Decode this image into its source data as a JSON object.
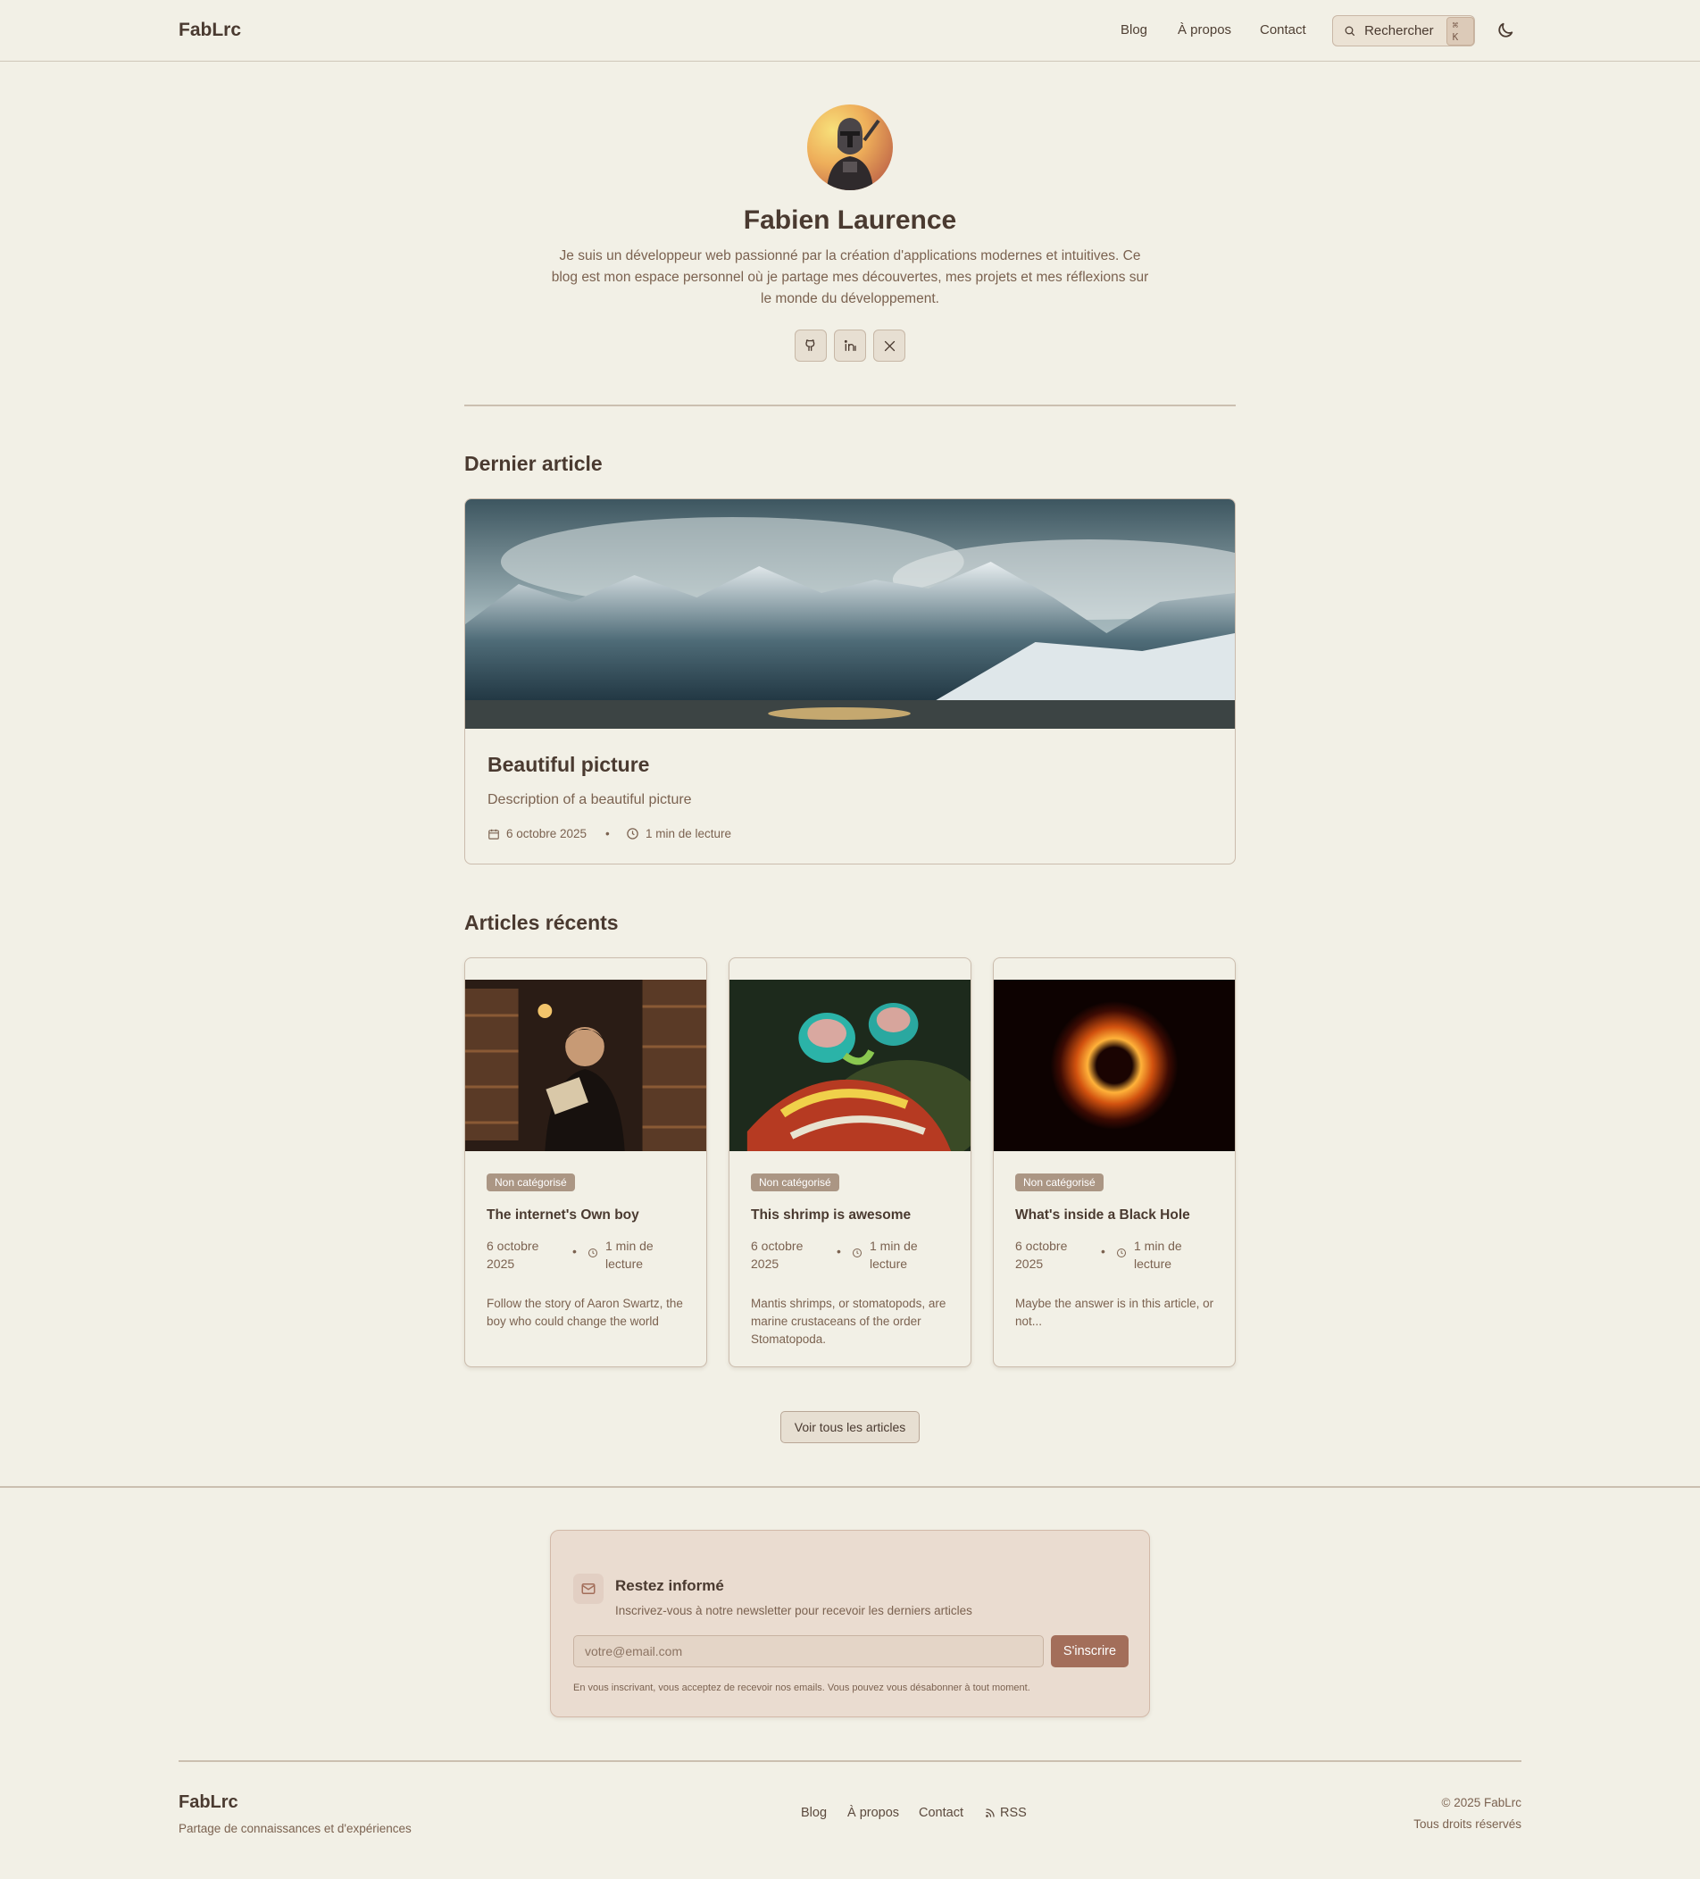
{
  "header": {
    "logo": "FabLrc",
    "nav": [
      "Blog",
      "À propos",
      "Contact"
    ],
    "search_label": "Rechercher",
    "search_kbd": "⌘ K",
    "icons": {
      "search": "search-icon",
      "theme": "moon-icon"
    }
  },
  "profile": {
    "name": "Fabien Laurence",
    "bio": "Je suis un développeur web passionné par la création d'applications modernes et intuitives. Ce blog est mon espace personnel où je partage mes découvertes, mes projets et mes réflexions sur le monde du développement.",
    "socials": [
      "github-icon",
      "linkedin-icon",
      "x-icon"
    ]
  },
  "latest": {
    "section_title": "Dernier article",
    "title": "Beautiful picture",
    "description": "Description of a beautiful picture",
    "date": "6 octobre 2025",
    "read_time": "1 min de lecture"
  },
  "recent": {
    "section_title": "Articles récents",
    "articles": [
      {
        "badge": "Non catégorisé",
        "title": "The internet's Own boy",
        "date": "6 octobre 2025",
        "read_time": "1 min de lecture",
        "excerpt": "Follow the story of Aaron Swartz, the boy who could change the world"
      },
      {
        "badge": "Non catégorisé",
        "title": "This shrimp is awesome",
        "date": "6 octobre 2025",
        "read_time": "1 min de lecture",
        "excerpt": "Mantis shrimps, or stomatopods, are marine crustaceans of the order Stomatopoda."
      },
      {
        "badge": "Non catégorisé",
        "title": "What's inside a Black Hole",
        "date": "6 octobre 2025",
        "read_time": "1 min de lecture",
        "excerpt": "Maybe the answer is in this article, or not..."
      }
    ],
    "see_all": "Voir tous les articles"
  },
  "newsletter": {
    "title": "Restez informé",
    "subtitle": "Inscrivez-vous à notre newsletter pour recevoir les derniers articles",
    "placeholder": "votre@email.com",
    "button": "S'inscrire",
    "note": "En vous inscrivant, vous acceptez de recevoir nos emails. Vous pouvez vous désabonner à tout moment."
  },
  "footer": {
    "logo": "FabLrc",
    "tagline": "Partage de connaissances et d'expériences",
    "links": [
      "Blog",
      "À propos",
      "Contact",
      "RSS"
    ],
    "copyright": "© 2025 FabLrc",
    "rights": "Tous droits réservés"
  },
  "colors": {
    "background": "#f2f0e6",
    "text": "#4a3a30",
    "muted": "#7b6250",
    "accent": "#a36e5a",
    "badge": "#ab9684"
  }
}
